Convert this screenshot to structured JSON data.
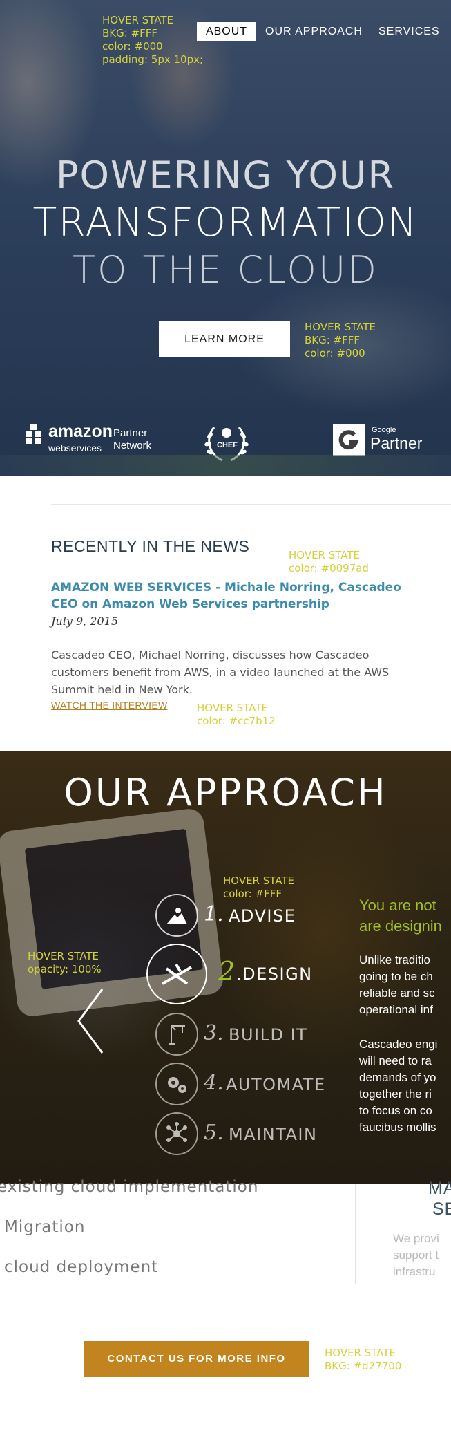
{
  "nav": {
    "hover_note": "HOVER STATE\nBKG: #FFF\ncolor: #000\npadding: 5px 10px;",
    "items": [
      "ABOUT",
      "OUR APPROACH",
      "SERVICES"
    ]
  },
  "hero": {
    "line1": "POWERING YOUR",
    "line2": "TRANSFORMATION",
    "line3": "TO THE CLOUD",
    "button": "LEARN MORE",
    "button_note": "HOVER STATE\nBKG: #FFF\ncolor: #000"
  },
  "partners": {
    "amazon_main": "amazon",
    "amazon_sub": "webservices",
    "amazon_partner": "Partner\nNetwork",
    "chef": "CHEF",
    "google_small": "Google",
    "google_partner": "Partner"
  },
  "news": {
    "heading": "RECENTLY IN THE NEWS",
    "heading_note": "HOVER STATE\ncolor: #0097ad",
    "title": "AMAZON WEB SERVICES - Michale Norring, Cascadeo CEO on Amazon Web Services partnership",
    "date": "July 9, 2015",
    "body": "Cascadeo CEO, Michael Norring, discusses how Cascadeo customers benefit from AWS, in a video launched at the AWS Summit held in New York.",
    "link": "WATCH THE INTERVIEW",
    "link_note": "HOVER STATE\ncolor: #cc7b12"
  },
  "approach": {
    "title": "OUR APPROACH",
    "step_note": "HOVER STATE\ncolor: #FFF",
    "arrow_note": "HOVER STATE\nopacity: 100%",
    "steps": [
      {
        "num": "1.",
        "label": "ADVISE"
      },
      {
        "num": "2",
        "label": ".DESIGN"
      },
      {
        "num": "3.",
        "label": "BUILD IT"
      },
      {
        "num": "4.",
        "label": "AUTOMATE"
      },
      {
        "num": "5.",
        "label": "MAINTAIN"
      }
    ],
    "side_heading": "You are not\nare designin",
    "side_p1": "Unlike traditio\ngoing to be ch\nreliable and sc\noperational inf",
    "side_p2": "Cascadeo engi\nwill need to ra\ndemands of yo\ntogether the ri\nto focus on co\nfaucibus mollis",
    "accent": "#9fc026"
  },
  "services": {
    "item1": "existing cloud implementation",
    "item2": "Migration",
    "item3": "cloud deployment",
    "right_title1": "MA",
    "right_title2": "SE",
    "right_body": "We provi\nsupport t\ninfrastru"
  },
  "contact": {
    "button": "CONTACT US FOR MORE INFO",
    "note": "HOVER STATE\nBKG: #d27700",
    "color": "#c2841f"
  }
}
